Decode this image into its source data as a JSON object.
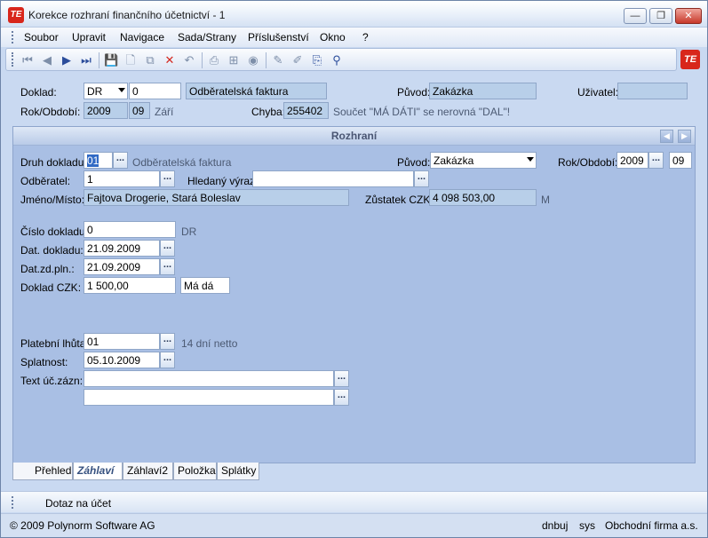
{
  "window": {
    "title": "Korekce rozhraní finančního účetnictví - 1",
    "logo_text": "TE",
    "minimize": "—",
    "restore": "❐",
    "close": "✕"
  },
  "menu": [
    "Soubor",
    "Upravit",
    "Navigace",
    "Sada/Strany",
    "Příslušenství",
    "Okno",
    "?"
  ],
  "header": {
    "doklad_label": "Doklad:",
    "doklad_type": "DR",
    "doklad_number": "0",
    "doklad_desc": "Odběratelská faktura",
    "puvod_label": "Původ:",
    "puvod_value": "Zakázka",
    "uzivatel_label": "Uživatel:",
    "uzivatel_value": "",
    "rok_label": "Rok/Období:",
    "rok_value": "2009",
    "obdobi_value": "09",
    "obdobi_name": "Září",
    "chyba_label": "Chyba:",
    "chyba_value": "255402",
    "chyba_msg": "Součet \"MÁ DÁTI\" se nerovná \"DAL\"!"
  },
  "panel": {
    "title": "Rozhraní",
    "druh_label": "Druh dokladu:",
    "druh_value": "01",
    "druh_desc": "Odběratelská faktura",
    "puvod_label": "Původ:",
    "puvod_value": "Zakázka",
    "rok_label": "Rok/Období:",
    "rok_value": "2009",
    "obdobi_value": "09",
    "odberatel_label": "Odběratel:",
    "odberatel_value": "1",
    "hledany_label": "Hledaný výraz:",
    "hledany_value": "",
    "jmeno_label": "Jméno/Místo:",
    "jmeno_value": "Fajtova Drogerie, Stará Boleslav",
    "zustatek_label": "Zůstatek CZK:",
    "zustatek_value": "4 098 503,00",
    "zustatek_suffix": "M",
    "cislo_label": "Číslo dokladu:",
    "cislo_value": "0",
    "cislo_suffix": "DR",
    "dat_dokladu_label": "Dat. dokladu:",
    "dat_dokladu_value": "21.09.2009",
    "dat_zd_label": "Dat.zd.pln.:",
    "dat_zd_value": "21.09.2009",
    "doklad_czk_label": "Doklad CZK:",
    "doklad_czk_value": "1 500,00",
    "doklad_czk_side": "Má dá",
    "lhuta_label": "Platební lhůta:",
    "lhuta_value": "01",
    "lhuta_desc": "14 dní netto",
    "splatnost_label": "Splatnost:",
    "splatnost_value": "05.10.2009",
    "text_label": "Text úč.zázn:",
    "text_value1": "",
    "text_value2": ""
  },
  "tabs": [
    "Přehled",
    "Záhlaví",
    "Záhlaví2",
    "Položka",
    "Splátky"
  ],
  "bottom": {
    "dotaz": "Dotaz na účet"
  },
  "status": {
    "copyright": "© 2009 Polynorm Software AG",
    "user": "dnbuj",
    "system": "sys",
    "company": "Obchodní firma a.s."
  }
}
